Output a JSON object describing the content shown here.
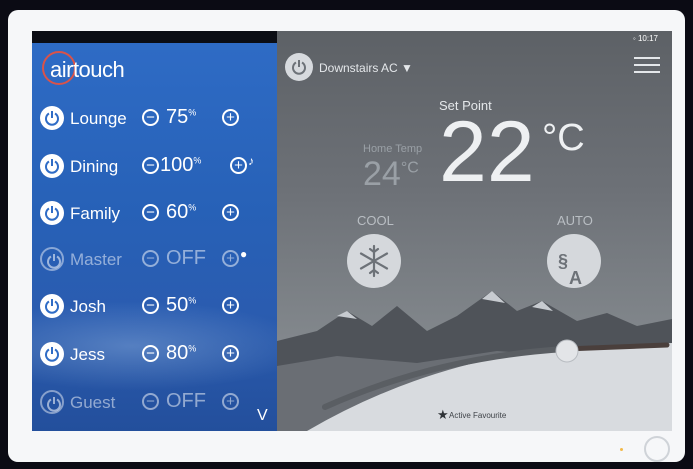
{
  "app": {
    "logo_text": "airtouch"
  },
  "status": {
    "time": "10:17"
  },
  "zones": [
    {
      "name": "Lounge",
      "value": "75",
      "unit": "%",
      "on": true,
      "extra": ""
    },
    {
      "name": "Dining",
      "value": "100",
      "unit": "%",
      "on": true,
      "extra": "♪"
    },
    {
      "name": "Family",
      "value": "60",
      "unit": "%",
      "on": true,
      "extra": ""
    },
    {
      "name": "Master",
      "value": "OFF",
      "unit": "",
      "on": false,
      "extra": "●"
    },
    {
      "name": "Josh",
      "value": "50",
      "unit": "%",
      "on": true,
      "extra": ""
    },
    {
      "name": "Jess",
      "value": "80",
      "unit": "%",
      "on": true,
      "extra": ""
    },
    {
      "name": "Guest",
      "value": "OFF",
      "unit": "",
      "on": false,
      "extra": ""
    }
  ],
  "main": {
    "unit_name": "Downstairs AC",
    "set_point_label": "Set Point",
    "set_point_value": "22",
    "set_point_unit": "°C",
    "home_temp_label": "Home Temp",
    "home_temp_value": "24",
    "home_temp_unit": "°C",
    "mode_label": "COOL",
    "fan_label": "AUTO",
    "fan_icon_text": "A",
    "favourite_label": "Active Favourite",
    "chevron": "V"
  },
  "colors": {
    "accent": "#2f6cc6",
    "logo_ring": "#d9534a"
  }
}
